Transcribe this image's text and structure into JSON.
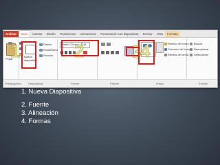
{
  "ribbon": {
    "tabs": [
      "Archivo",
      "Inicio",
      "Insertar",
      "Diseño",
      "Transiciones",
      "Animaciones",
      "Presentación con diapositivas",
      "Revisar",
      "Vista",
      "Formato"
    ],
    "groups": [
      "Portapapeles",
      "Diapositivas",
      "Fuente",
      "Párrafo",
      "Dibujo",
      "Edición"
    ],
    "clipboard": {
      "paste_label": "Pegar"
    },
    "slides": {
      "new_slide_label": "Nueva diapositiva",
      "layout_label": "Diseño",
      "reset_label": "Restablecer",
      "section_label": "Sección"
    },
    "font": {
      "font_name": "Calibri (Título)",
      "font_size": "44"
    },
    "drawing": {
      "shapes_fill": "Relleno de forma",
      "shapes_outline": "Contorno de forma",
      "shapes_effects": "Efectos de forma",
      "quick_styles": "Estilos rápidos",
      "arrange": "Organizar"
    },
    "editing": {
      "find": "Buscar",
      "replace": "Reemplazar",
      "select": "Seleccionar"
    },
    "callouts": [
      "1",
      "2",
      "3",
      "4"
    ]
  },
  "list": {
    "items": [
      "1. Nueva Diapositiva",
      "2. Fuente",
      "3. Alineación",
      "4. Formas"
    ]
  },
  "colors": {
    "callout": "#e21b1b",
    "background": "#3f4a57",
    "accent": "#c8412b"
  }
}
